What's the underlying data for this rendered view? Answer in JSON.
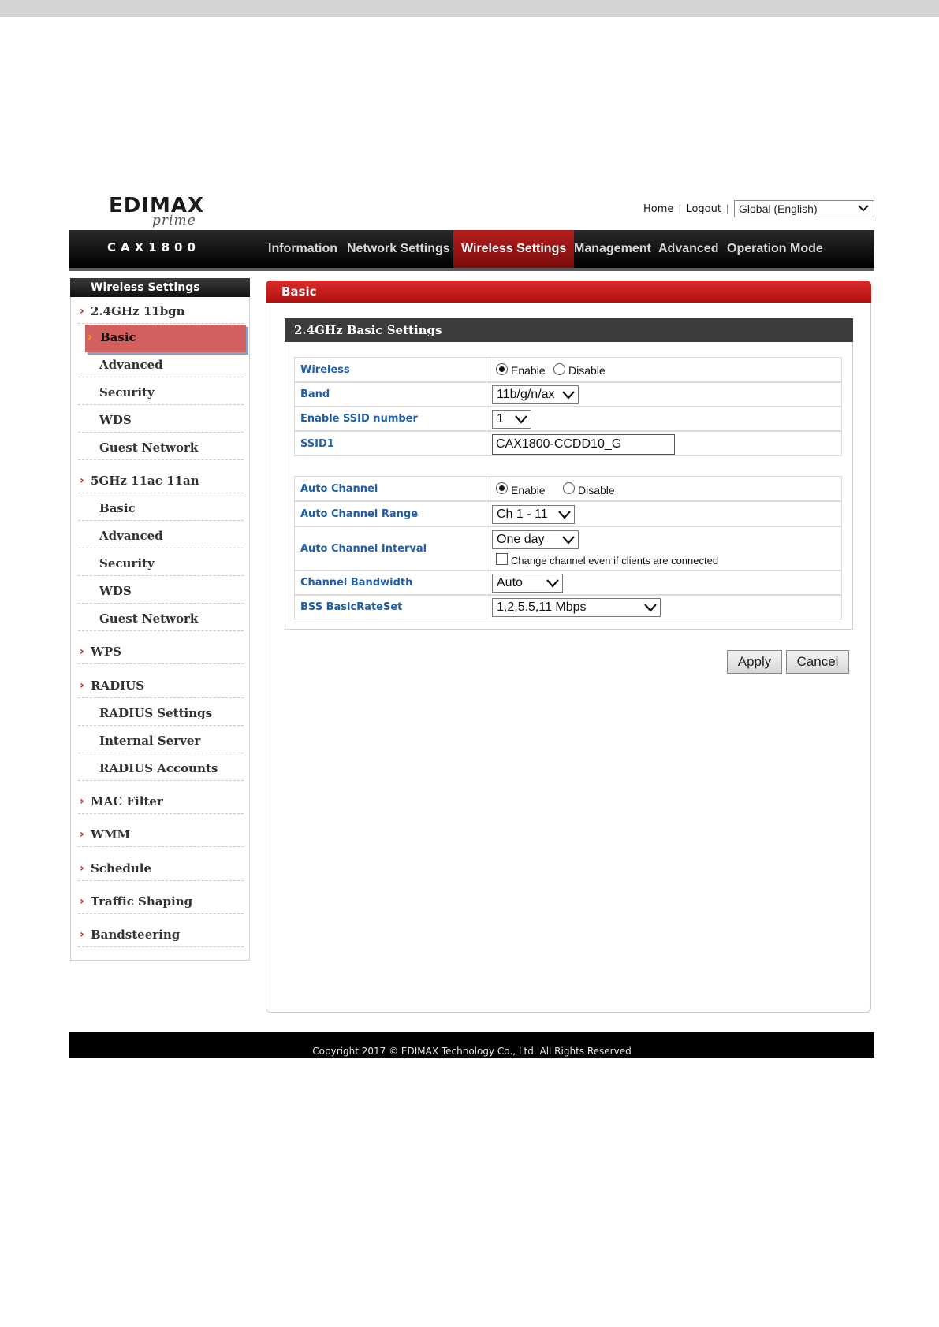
{
  "brand": {
    "logo": "EDIMAX",
    "logo_sub": "prime",
    "model": "CAX1800"
  },
  "header": {
    "home": "Home",
    "sep": "|",
    "logout": "Logout",
    "language": "Global (English)"
  },
  "nav": {
    "items": [
      "Information",
      "Network Settings",
      "Wireless Settings",
      "Management",
      "Advanced",
      "Operation Mode"
    ],
    "active": "Wireless Settings"
  },
  "sidebar": {
    "title": "Wireless Settings",
    "items": [
      {
        "label": "2.4GHz 11bgn",
        "type": "group"
      },
      {
        "label": "Basic",
        "type": "sub",
        "active": true
      },
      {
        "label": "Advanced",
        "type": "sub"
      },
      {
        "label": "Security",
        "type": "sub"
      },
      {
        "label": "WDS",
        "type": "sub"
      },
      {
        "label": "Guest Network",
        "type": "sub"
      },
      {
        "label": "5GHz 11ac 11an",
        "type": "group"
      },
      {
        "label": "Basic",
        "type": "sub"
      },
      {
        "label": "Advanced",
        "type": "sub"
      },
      {
        "label": "Security",
        "type": "sub"
      },
      {
        "label": "WDS",
        "type": "sub"
      },
      {
        "label": "Guest Network",
        "type": "sub"
      },
      {
        "label": "WPS",
        "type": "group"
      },
      {
        "label": "RADIUS",
        "type": "group"
      },
      {
        "label": "RADIUS Settings",
        "type": "sub"
      },
      {
        "label": "Internal Server",
        "type": "sub"
      },
      {
        "label": "RADIUS Accounts",
        "type": "sub"
      },
      {
        "label": "MAC Filter",
        "type": "group"
      },
      {
        "label": "WMM",
        "type": "group"
      },
      {
        "label": "Schedule",
        "type": "group"
      },
      {
        "label": "Traffic Shaping",
        "type": "group"
      },
      {
        "label": "Bandsteering",
        "type": "group"
      }
    ]
  },
  "panel": {
    "title": "Basic",
    "section_title": "2.4GHz Basic Settings",
    "fields": {
      "wireless": {
        "label": "Wireless",
        "enable": "Enable",
        "disable": "Disable",
        "selected": "Enable"
      },
      "band": {
        "label": "Band",
        "value": "11b/g/n/ax"
      },
      "ssid_number": {
        "label": "Enable SSID number",
        "value": "1"
      },
      "ssid1": {
        "label": "SSID1",
        "value": "CAX1800-CCDD10_G"
      },
      "auto_channel": {
        "label": "Auto Channel",
        "enable": "Enable",
        "disable": "Disable",
        "selected": "Enable"
      },
      "auto_channel_range": {
        "label": "Auto Channel Range",
        "value": "Ch 1 - 11"
      },
      "auto_channel_interval": {
        "label": "Auto Channel Interval",
        "value": "One day",
        "checkbox_label": "Change channel even if clients are connected",
        "checked": false
      },
      "channel_bandwidth": {
        "label": "Channel Bandwidth",
        "value": "Auto"
      },
      "bss_basic_rate_set": {
        "label": "BSS BasicRateSet",
        "value": "1,2,5.5,11 Mbps"
      }
    },
    "buttons": {
      "apply": "Apply",
      "cancel": "Cancel"
    }
  },
  "footer": {
    "copyright": "Copyright 2017 © EDIMAX Technology Co., Ltd. All Rights Reserved"
  },
  "colors": {
    "accent_red": "#c01515",
    "label_blue": "#1f5ea8",
    "active_sidebar": "#d45f5f"
  }
}
